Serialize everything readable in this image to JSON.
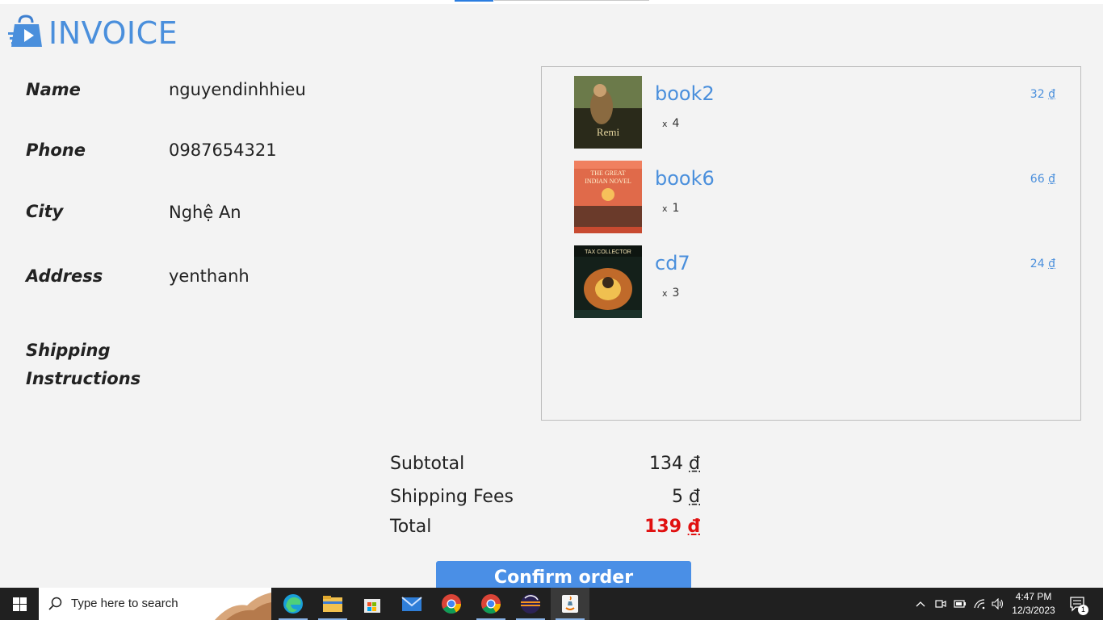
{
  "header": {
    "title": "INVOICE"
  },
  "form": {
    "name_label": "Name",
    "name_value": "nguyendinhhieu",
    "phone_label": "Phone",
    "phone_value": "0987654321",
    "city_label": "City",
    "city_value": "Nghệ An",
    "address_label": "Address",
    "address_value": "yenthanh",
    "shipping_label_line1": "Shipping",
    "shipping_label_line2": "Instructions"
  },
  "cart": {
    "items": [
      {
        "name": "book2",
        "qty_prefix": "x",
        "qty": "4",
        "price": "32",
        "currency": "₫",
        "cover": "book-cover-image"
      },
      {
        "name": "book6",
        "qty_prefix": "x",
        "qty": "1",
        "price": "66",
        "currency": "₫",
        "cover": "book-cover-image"
      },
      {
        "name": "cd7",
        "qty_prefix": "x",
        "qty": "3",
        "price": "24",
        "currency": "₫",
        "cover": "cd-cover-image"
      }
    ]
  },
  "summary": {
    "subtotal_label": "Subtotal",
    "subtotal_value": "134",
    "shipping_label": "Shipping Fees",
    "shipping_value": "5",
    "total_label": "Total",
    "total_value": "139",
    "currency": "₫"
  },
  "actions": {
    "confirm_label": "Confirm order"
  },
  "taskbar": {
    "search_placeholder": "Type here to search",
    "apps": [
      "edge-icon",
      "file-explorer-icon",
      "store-icon",
      "mail-icon",
      "chrome-icon",
      "chrome-icon",
      "eclipse-icon",
      "java-icon"
    ],
    "time": "4:47 PM",
    "date": "12/3/2023",
    "notification_count": "1"
  },
  "colors": {
    "accent": "#4a8fdc",
    "total": "#e01010",
    "button": "#4a8fe6",
    "taskbar": "#202020"
  }
}
